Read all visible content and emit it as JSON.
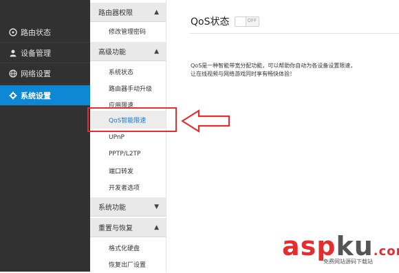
{
  "sidebar": {
    "items": [
      {
        "label": "路由状态",
        "icon": "gauge-icon"
      },
      {
        "label": "设备管理",
        "icon": "user-icon"
      },
      {
        "label": "网络设置",
        "icon": "globe-icon"
      },
      {
        "label": "系统设置",
        "icon": "gear-icon",
        "active": true
      }
    ]
  },
  "submenu": {
    "group_router_perm": {
      "label": "路由器权限",
      "chevron": "chevron-up-icon",
      "items": [
        "修改管理密码"
      ]
    },
    "group_advanced": {
      "label": "高级功能",
      "chevron": "chevron-up-icon",
      "items": [
        "系统状态",
        "路由器手动升级",
        "应用限速",
        "QoS智能限速",
        "UPnP",
        "PPTP/L2TP",
        "端口转发",
        "开发者选项"
      ]
    },
    "group_system": {
      "label": "系统功能",
      "chevron": "chevron-down-icon"
    },
    "group_reset": {
      "label": "重置与恢复",
      "chevron": "chevron-up-icon",
      "items": [
        "格式化硬盘",
        "恢复出厂设置"
      ]
    }
  },
  "main": {
    "title": "QoS状态",
    "toggle_label": "OFF",
    "toggle_on": false,
    "description": [
      "QoS是一种智能带宽分配功能，可以帮助你自动为各设备设置限速，",
      "让在线视频与网络游戏同时享有畅快体验！"
    ]
  },
  "watermark": {
    "brand_a": "asp",
    "brand_b": "ku",
    "brand_c": ".com",
    "tagline": "免费网站源码下载站"
  },
  "colors": {
    "accent": "#0e87d4",
    "highlight": "#e52d2d",
    "sidebar_bg": "#313131"
  }
}
